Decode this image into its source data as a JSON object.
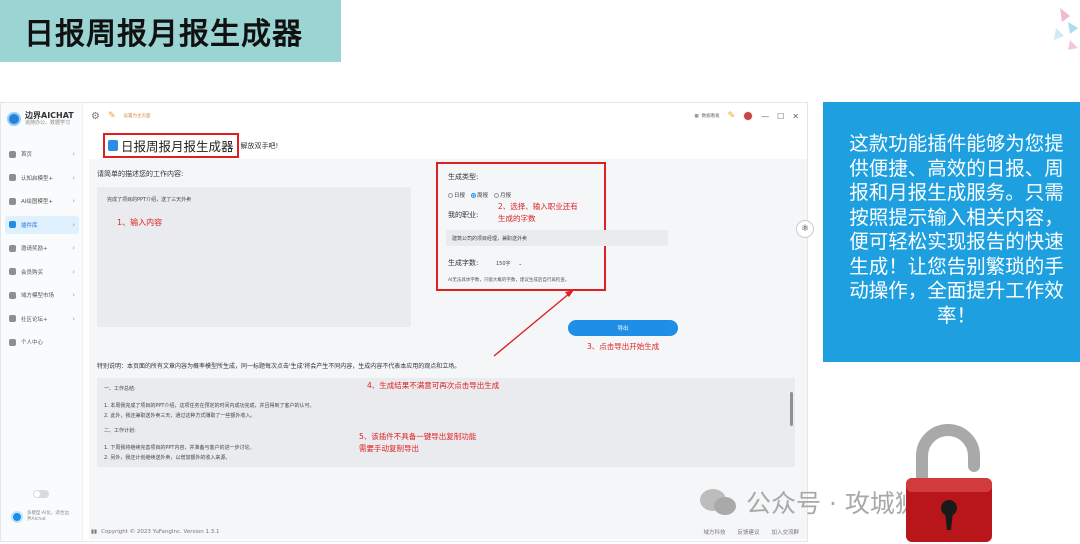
{
  "slide": {
    "title": "日报周报月报生成器",
    "info_text": "这款功能插件能够为您提供便捷、高效的日报、周报和月报生成服务。只需按照提示输入相关内容，便可轻松实现报告的快速生成！让您告别繁琐的手动操作，全面提升工作效率！",
    "watermark": "公众号 · 攻城狮Joker"
  },
  "app": {
    "brand_name": "边界AICHAT",
    "brand_sub": "追随办公、数据学习",
    "sidebar": {
      "items": [
        {
          "label": "首页"
        },
        {
          "label": "认知启模型+"
        },
        {
          "label": "AI绘图模型+"
        },
        {
          "label": "插件库"
        },
        {
          "label": "邀请奖励+"
        },
        {
          "label": "会员购买"
        },
        {
          "label": "域方模型市场"
        },
        {
          "label": "社区论坛+"
        },
        {
          "label": "个人中心"
        }
      ],
      "bottom_text": "多模型·AI化，适合边界AIchat"
    },
    "topbar": {
      "fav_link": "设置为主页面",
      "dashboard": "数据看板"
    },
    "plugin": {
      "title": "日报周报月报生成器",
      "subtitle": "解放双手吧!"
    },
    "form": {
      "prompt_label": "请简单的描述您的工作内容:",
      "prompt_value": "完成了项目的PPT介绍，送了三天外卖",
      "type_label": "生成类型:",
      "types": [
        "日报",
        "周报",
        "月报"
      ],
      "job_label": "我的职业:",
      "job_value": "建筑公司的项目经理，兼职送外卖",
      "count_label": "生成字数:",
      "count_value": "150字",
      "note": "AI无法具体字数，只能大概的字数，建议生成后自行再检查。",
      "export_label": "导出",
      "special_note": "特别说明：本页面的所有文章内容为概率模型所生成，同一标题每次点击'生成'将会产生不同内容，生成内容不代表本应用的观点和立场。"
    },
    "output": {
      "lines": [
        "一、工作总结:",
        "1. 本周我完成了项目的PPT介绍，这项任务在预定的时间内成功完成，并且得到了客户的认可。",
        "2. 此外，我还兼职送外卖三天，通过这种方式赚取了一些额外收入。",
        "二、工作计划:",
        "1. 下周我将继续完善项目的PPT内容，并准备与客户的进一步讨论。",
        "2. 另外，我还计划继续送外卖，以增加额外的收入来源。"
      ]
    },
    "footer": {
      "copyright": "Copyright © 2023 YuFangInc. Version 1.3.1",
      "links": [
        "域方科技",
        "反馈建议",
        "加入交流群"
      ]
    }
  },
  "annotations": {
    "a1": "1、输入内容",
    "a2_line1": "2、选择、输入职业还有",
    "a2_line2": "生成的字数",
    "a3": "3、点击导出开始生成",
    "a4": "4、生成结果不满意可再次点击导出生成",
    "a5_line1": "5、该插件不具备一键导出复制功能",
    "a5_line2": "需要手动复制导出"
  },
  "colors": {
    "banner": "#9ad5d4",
    "info_panel": "#1ea0e0",
    "accent": "#1f8ee6",
    "annotation": "#e02020"
  }
}
